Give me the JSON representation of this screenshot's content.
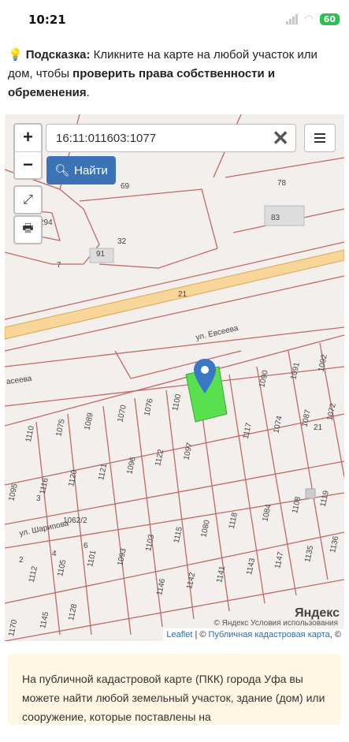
{
  "status": {
    "time": "10:21",
    "battery": "60"
  },
  "hint": {
    "prefix": "Подсказка:",
    "text1": "Кликните на карте на любой участок или дом, чтобы",
    "strong": "проверить права собственности и обременения",
    "end": "."
  },
  "search": {
    "value": "16:11:011603:1077",
    "clear": "✕",
    "button": "Найти"
  },
  "zoom": {
    "in": "+",
    "out": "−"
  },
  "map": {
    "streets": [
      "ул. Евсеева",
      "асеева",
      "ул. Шарипова"
    ],
    "road_number": "21",
    "parcels": [
      "1110",
      "1075",
      "1089",
      "1070",
      "1076",
      "1100",
      "1090",
      "1091",
      "1092",
      "1117",
      "1074",
      "1087",
      "1072",
      "1116",
      "1120",
      "1121",
      "1096",
      "1122",
      "1097",
      "1095",
      "1062/2",
      "1118",
      "1084",
      "1108",
      "1119",
      "1080",
      "1115",
      "1103",
      "1093",
      "1101",
      "1105",
      "1112",
      "1146",
      "1142",
      "1141",
      "1143",
      "1147",
      "1135",
      "1136",
      "1145",
      "1128",
      "1170",
      "78",
      "83",
      "69",
      "91",
      "32",
      "294",
      "7",
      "21",
      "3",
      "4",
      "6",
      "2"
    ]
  },
  "attribution": {
    "leaflet": "Leaflet",
    "sep": "| ©",
    "pkk": "Публичная кадастровая карта",
    "tail": ", ©",
    "yandex": "Яндекс",
    "yandex_note": "© Яндекс  Условия использования"
  },
  "info": {
    "text": "На публичной кадастровой карте (ПКК) города Уфа вы можете найти любой земельный участок, здание (дом) или сооружение, которые поставлены на"
  }
}
